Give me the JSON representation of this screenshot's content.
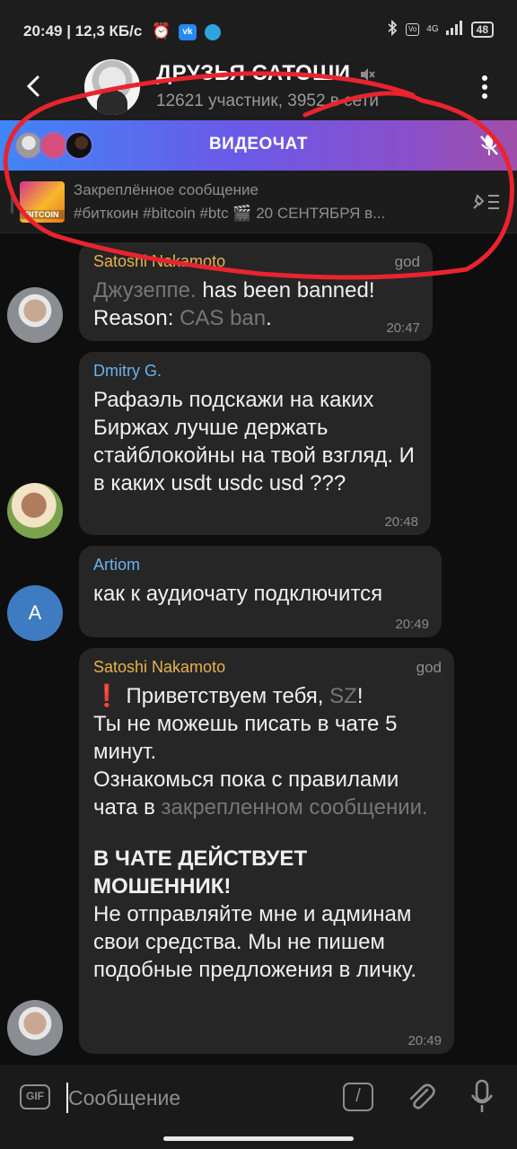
{
  "status_bar": {
    "time": "20:49",
    "speed": "12,3 КБ/с",
    "vk_label": "vk",
    "network": "4G",
    "battery": "48",
    "icons": [
      "alarm-icon",
      "vk-icon",
      "telegram-icon",
      "bluetooth-icon",
      "volte-icon",
      "signal-icon",
      "battery-icon"
    ]
  },
  "header": {
    "title": "ДРУЗЬЯ САТОШИ",
    "subtitle": "12621 участник, 3952 в сети"
  },
  "videochat": {
    "label": "ВИДЕОЧАТ",
    "colors": {
      "from": "#3f86f7",
      "to": "#a04fa9"
    }
  },
  "pinned": {
    "title": "Закреплённое сообщение",
    "text": "#биткоин #bitcoin #btc 🎬 20 СЕНТЯБРЯ в...",
    "thumb_text": "BITCOIN"
  },
  "messages": [
    {
      "sender": "Satoshi Nakamoto",
      "role": "god",
      "line1_user": "Джузеппе.",
      "line1_rest": " has been banned!",
      "line2_label": "Reason: ",
      "line2_reason": "CAS ban",
      "line2_end": ".",
      "time": "20:47"
    },
    {
      "sender": "Dmitry G.",
      "text": "Рафаэль подскажи на каких Биржах лучше держать стайблокойны на твой взгляд. И в каких usdt usdc usd ???",
      "time": "20:48"
    },
    {
      "sender": "Artiom",
      "avatar_letter": "A",
      "text": "как к аудиочату подключится",
      "time": "20:49"
    },
    {
      "sender": "Satoshi Nakamoto",
      "role": "god",
      "p1_icon": "❗",
      "p1_text": " Приветствуем тебя, ",
      "p1_user": "SZ",
      "p1_end": "!",
      "p2": "Ты не можешь писать в чате 5 минут.",
      "p3": "Ознакомься пока с правилами чата в",
      "p3_link": "закрепленном сообщении.",
      "warning": "В ЧАТЕ ДЕЙСТВУЕТ МОШЕННИК!",
      "p4": "Не отправляйте мне и админам свои средства. Мы не пишем подобные предложения в личку.",
      "time": "20:49"
    }
  ],
  "input": {
    "placeholder": "Сообщение",
    "gif_label": "GIF",
    "command_label": "/"
  },
  "colors": {
    "accent_blue": "#6cb1ed",
    "accent_gold": "#e7b34a",
    "annotation_red": "#e8242f",
    "bubble_bg": "#262626"
  }
}
